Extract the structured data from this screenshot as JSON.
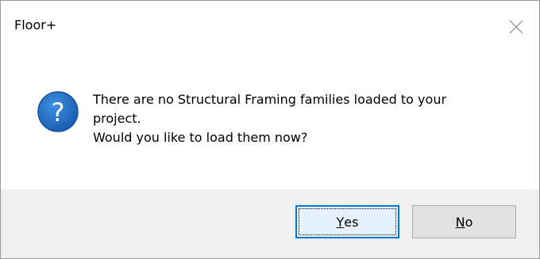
{
  "window": {
    "title": "Floor+",
    "close_icon": "close-icon"
  },
  "message": {
    "icon": "question-icon",
    "icon_glyph": "?",
    "lines": [
      "There are no Structural Framing families loaded to your",
      "project.",
      "Would you like to load them now?"
    ]
  },
  "buttons": {
    "yes": {
      "accel": "Y",
      "rest": "es"
    },
    "no": {
      "accel": "N",
      "rest": "o"
    }
  },
  "colors": {
    "icon_blue": "#1f6fc5",
    "default_button_border": "#0078d7",
    "footer_background": "#f0f0f0"
  }
}
